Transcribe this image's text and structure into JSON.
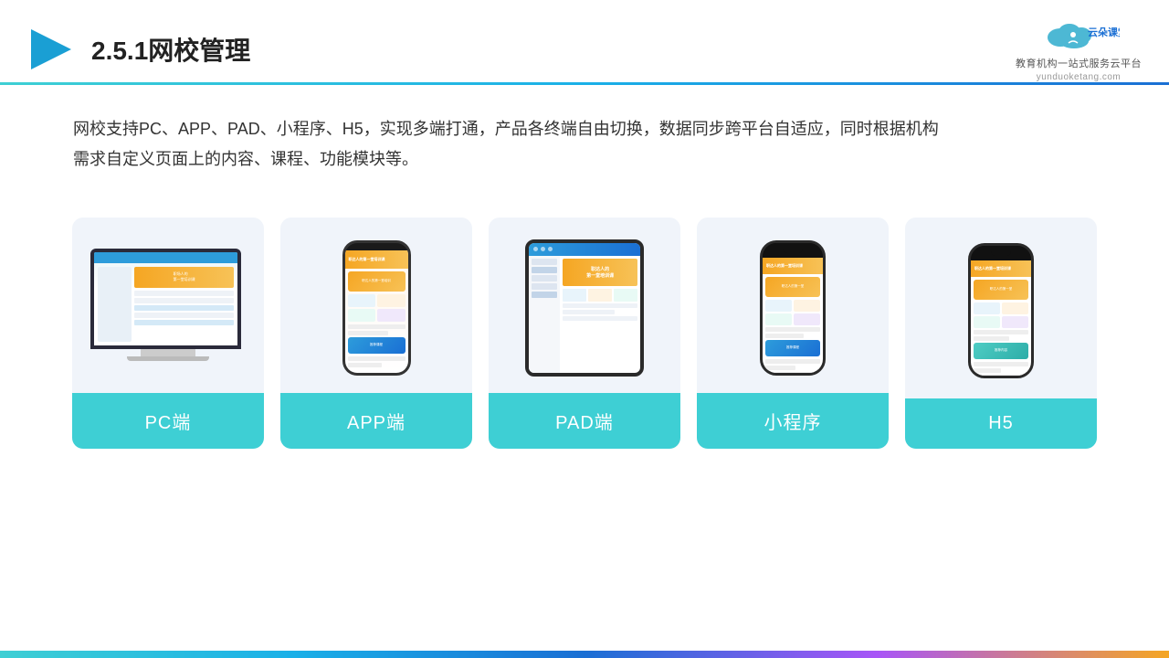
{
  "header": {
    "title": "2.5.1网校管理",
    "logo_main": "云朵课堂",
    "logo_sub": "yunduoketang.com",
    "logo_tagline": "教育机构一站式服务云平台"
  },
  "description": {
    "line1": "网校支持PC、APP、PAD、小程序、H5，实现多端打通，产品各终端自由切换，数据同步跨平台自适应，同时根据机构",
    "line2": "需求自定义页面上的内容、课程、功能模块等。"
  },
  "cards": [
    {
      "id": "pc",
      "label": "PC端"
    },
    {
      "id": "app",
      "label": "APP端"
    },
    {
      "id": "pad",
      "label": "PAD端"
    },
    {
      "id": "miniprogram",
      "label": "小程序"
    },
    {
      "id": "h5",
      "label": "H5"
    }
  ],
  "colors": {
    "accent": "#3ecfd4",
    "brand_blue": "#1a6fd4",
    "orange": "#f5a623",
    "divider_gradient": "linear-gradient(to right, #3ecfd4, #1ab0e8, #1a6fd4)"
  }
}
